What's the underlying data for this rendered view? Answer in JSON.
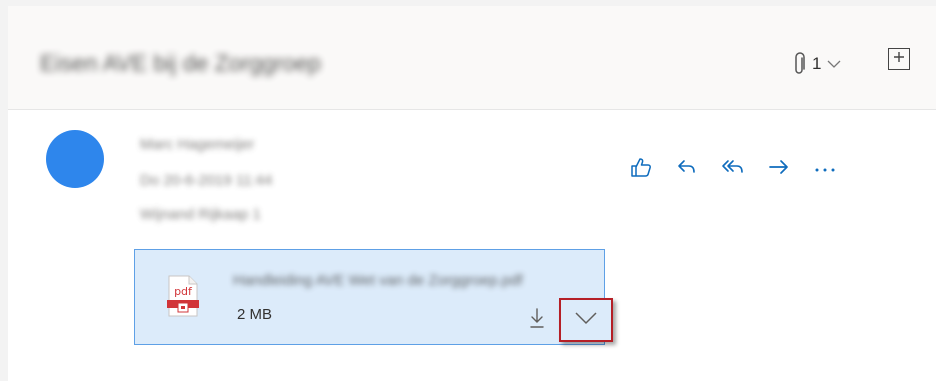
{
  "header": {
    "subject": "Eisen AVE bij de Zorggroep",
    "attachment_count": "1",
    "icons": {
      "attach": "paperclip-icon",
      "dropdown": "chevron-down-icon",
      "expand": "expand-square-icon"
    }
  },
  "message": {
    "sender": "Marc Hagemeijer",
    "date": "Do 20-6-2019 11:44",
    "recipients": "Wijnand Rijkaap 1",
    "avatar_color": "#2e86ec",
    "actions": [
      {
        "name": "like-icon"
      },
      {
        "name": "reply-icon"
      },
      {
        "name": "reply-all-icon"
      },
      {
        "name": "forward-icon"
      },
      {
        "name": "more-actions-icon"
      }
    ]
  },
  "attachment": {
    "file_name": "Handleiding AVE Wet van de Zorggroep.pdf",
    "file_size": "2 MB",
    "icon_label": "pdf",
    "highlight_color": "#b51f26"
  },
  "colors": {
    "accent": "#0f6cbd",
    "card_bg": "#dcebfa",
    "card_border": "#5ea0e6"
  }
}
